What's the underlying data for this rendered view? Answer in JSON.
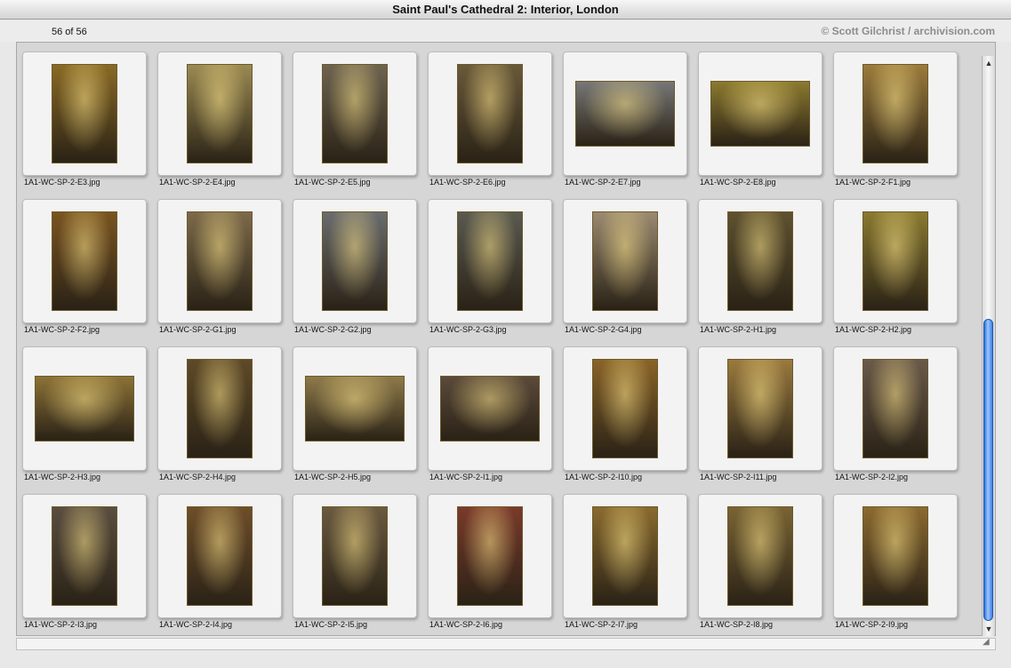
{
  "window": {
    "title": "Saint Paul's Cathedral 2: Interior, London"
  },
  "info": {
    "count": "56 of 56",
    "credit": "© Scott Gilchrist / archivision.com"
  },
  "scrollbar": {
    "up_icon": "up-arrow-icon",
    "down_icon": "down-arrow-icon"
  },
  "thumbnails": [
    {
      "file": "1A1-WC-SP-2-E3.jpg",
      "shape": "portrait",
      "bg": "#8a6a24"
    },
    {
      "file": "1A1-WC-SP-2-E4.jpg",
      "shape": "portrait",
      "bg": "#9a8a52"
    },
    {
      "file": "1A1-WC-SP-2-E5.jpg",
      "shape": "portrait",
      "bg": "#6e6450"
    },
    {
      "file": "1A1-WC-SP-2-E6.jpg",
      "shape": "portrait",
      "bg": "#6a5a3a"
    },
    {
      "file": "1A1-WC-SP-2-E7.jpg",
      "shape": "landscape",
      "bg": "#777777"
    },
    {
      "file": "1A1-WC-SP-2-E8.jpg",
      "shape": "landscape",
      "bg": "#8c7a2e"
    },
    {
      "file": "1A1-WC-SP-2-F1.jpg",
      "shape": "portrait",
      "bg": "#9c7c3c"
    },
    {
      "file": "1A1-WC-SP-2-F2.jpg",
      "shape": "portrait",
      "bg": "#7a5420"
    },
    {
      "file": "1A1-WC-SP-2-G1.jpg",
      "shape": "portrait",
      "bg": "#7c6a4a"
    },
    {
      "file": "1A1-WC-SP-2-G2.jpg",
      "shape": "portrait",
      "bg": "#6a6c6e"
    },
    {
      "file": "1A1-WC-SP-2-G3.jpg",
      "shape": "portrait",
      "bg": "#5a5a50"
    },
    {
      "file": "1A1-WC-SP-2-G4.jpg",
      "shape": "portrait",
      "bg": "#9a8a70"
    },
    {
      "file": "1A1-WC-SP-2-H1.jpg",
      "shape": "portrait",
      "bg": "#5e5230"
    },
    {
      "file": "1A1-WC-SP-2-H2.jpg",
      "shape": "portrait",
      "bg": "#8a7a30"
    },
    {
      "file": "1A1-WC-SP-2-H3.jpg",
      "shape": "landscape",
      "bg": "#8c7236"
    },
    {
      "file": "1A1-WC-SP-2-H4.jpg",
      "shape": "portrait",
      "bg": "#5e4a28"
    },
    {
      "file": "1A1-WC-SP-2-H5.jpg",
      "shape": "landscape",
      "bg": "#8e7a4a"
    },
    {
      "file": "1A1-WC-SP-2-I1.jpg",
      "shape": "landscape",
      "bg": "#5a4a3a"
    },
    {
      "file": "1A1-WC-SP-2-I10.jpg",
      "shape": "portrait",
      "bg": "#8a6428"
    },
    {
      "file": "1A1-WC-SP-2-I11.jpg",
      "shape": "portrait",
      "bg": "#9a7a3e"
    },
    {
      "file": "1A1-WC-SP-2-I2.jpg",
      "shape": "portrait",
      "bg": "#6a5a4a"
    },
    {
      "file": "1A1-WC-SP-2-I3.jpg",
      "shape": "portrait",
      "bg": "#5a4e40"
    },
    {
      "file": "1A1-WC-SP-2-I4.jpg",
      "shape": "portrait",
      "bg": "#6e4e2a"
    },
    {
      "file": "1A1-WC-SP-2-I5.jpg",
      "shape": "portrait",
      "bg": "#6a5a40"
    },
    {
      "file": "1A1-WC-SP-2-I6.jpg",
      "shape": "portrait",
      "bg": "#7a3a2a"
    },
    {
      "file": "1A1-WC-SP-2-I7.jpg",
      "shape": "portrait",
      "bg": "#8a6a2e"
    },
    {
      "file": "1A1-WC-SP-2-I8.jpg",
      "shape": "portrait",
      "bg": "#7a6434"
    },
    {
      "file": "1A1-WC-SP-2-I9.jpg",
      "shape": "portrait",
      "bg": "#8c6a30"
    }
  ]
}
